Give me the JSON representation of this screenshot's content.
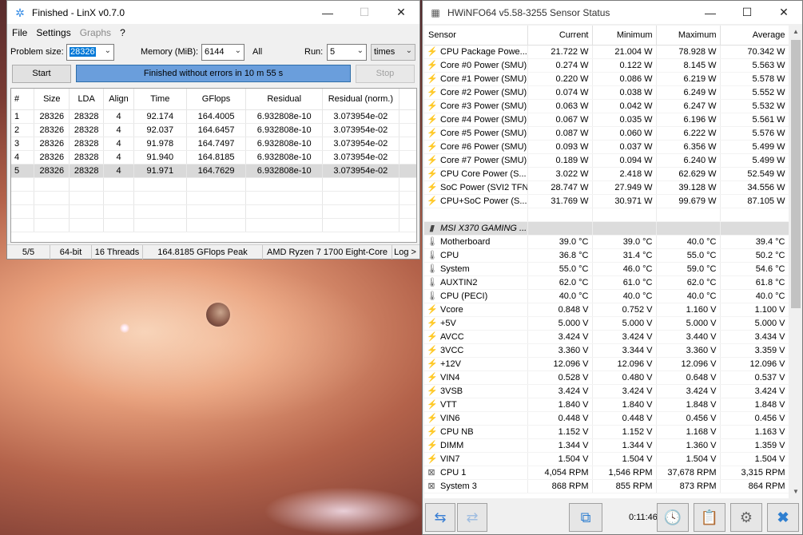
{
  "linx": {
    "title": "Finished - LinX v0.7.0",
    "menu": [
      "File",
      "Settings",
      "Graphs",
      "?"
    ],
    "params": {
      "problem_size_label": "Problem size:",
      "problem_size_value": "28326",
      "memory_label": "Memory (MiB):",
      "memory_value": "6144",
      "all_label": "All",
      "run_label": "Run:",
      "run_value": "5",
      "times_value": "times"
    },
    "buttons": {
      "start": "Start",
      "stop": "Stop"
    },
    "status_text": "Finished without errors in 10 m 55 s",
    "columns": [
      "#",
      "Size",
      "LDA",
      "Align",
      "Time",
      "GFlops",
      "Residual",
      "Residual (norm.)"
    ],
    "rows": [
      [
        "1",
        "28326",
        "28328",
        "4",
        "92.174",
        "164.4005",
        "6.932808e-10",
        "3.073954e-02"
      ],
      [
        "2",
        "28326",
        "28328",
        "4",
        "92.037",
        "164.6457",
        "6.932808e-10",
        "3.073954e-02"
      ],
      [
        "3",
        "28326",
        "28328",
        "4",
        "91.978",
        "164.7497",
        "6.932808e-10",
        "3.073954e-02"
      ],
      [
        "4",
        "28326",
        "28328",
        "4",
        "91.940",
        "164.8185",
        "6.932808e-10",
        "3.073954e-02"
      ],
      [
        "5",
        "28326",
        "28328",
        "4",
        "91.971",
        "164.7629",
        "6.932808e-10",
        "3.073954e-02"
      ]
    ],
    "statusbar": {
      "progress": "5/5",
      "bits": "64-bit",
      "threads": "16 Threads",
      "peak": "164.8185 GFlops Peak",
      "cpu": "AMD Ryzen 7 1700 Eight-Core",
      "log": "Log >"
    }
  },
  "hwinfo": {
    "title": "HWiNFO64 v5.58-3255 Sensor Status",
    "columns": [
      "Sensor",
      "Current",
      "Minimum",
      "Maximum",
      "Average"
    ],
    "rows": [
      {
        "icon": "power",
        "name": "CPU Package Powe...",
        "cur": "21.722 W",
        "min": "21.004 W",
        "max": "78.928 W",
        "avg": "70.342 W"
      },
      {
        "icon": "power",
        "name": "Core #0 Power (SMU)",
        "cur": "0.274 W",
        "min": "0.122 W",
        "max": "8.145 W",
        "avg": "5.563 W"
      },
      {
        "icon": "power",
        "name": "Core #1 Power (SMU)",
        "cur": "0.220 W",
        "min": "0.086 W",
        "max": "6.219 W",
        "avg": "5.578 W"
      },
      {
        "icon": "power",
        "name": "Core #2 Power (SMU)",
        "cur": "0.074 W",
        "min": "0.038 W",
        "max": "6.249 W",
        "avg": "5.552 W"
      },
      {
        "icon": "power",
        "name": "Core #3 Power (SMU)",
        "cur": "0.063 W",
        "min": "0.042 W",
        "max": "6.247 W",
        "avg": "5.532 W"
      },
      {
        "icon": "power",
        "name": "Core #4 Power (SMU)",
        "cur": "0.067 W",
        "min": "0.035 W",
        "max": "6.196 W",
        "avg": "5.561 W"
      },
      {
        "icon": "power",
        "name": "Core #5 Power (SMU)",
        "cur": "0.087 W",
        "min": "0.060 W",
        "max": "6.222 W",
        "avg": "5.576 W"
      },
      {
        "icon": "power",
        "name": "Core #6 Power (SMU)",
        "cur": "0.093 W",
        "min": "0.037 W",
        "max": "6.356 W",
        "avg": "5.499 W"
      },
      {
        "icon": "power",
        "name": "Core #7 Power (SMU)",
        "cur": "0.189 W",
        "min": "0.094 W",
        "max": "6.240 W",
        "avg": "5.499 W"
      },
      {
        "icon": "power",
        "name": "CPU Core Power (S...",
        "cur": "3.022 W",
        "min": "2.418 W",
        "max": "62.629 W",
        "avg": "52.549 W"
      },
      {
        "icon": "power",
        "name": "SoC Power (SVI2 TFN)",
        "cur": "28.747 W",
        "min": "27.949 W",
        "max": "39.128 W",
        "avg": "34.556 W"
      },
      {
        "icon": "power",
        "name": "CPU+SoC Power (S...",
        "cur": "31.769 W",
        "min": "30.971 W",
        "max": "99.679 W",
        "avg": "87.105 W"
      },
      {
        "icon": "blank",
        "name": "",
        "cur": "",
        "min": "",
        "max": "",
        "avg": ""
      },
      {
        "icon": "chip",
        "name": "MSI X370 GAMING ...",
        "cur": "",
        "min": "",
        "max": "",
        "avg": "",
        "group": true
      },
      {
        "icon": "temp",
        "name": "Motherboard",
        "cur": "39.0 °C",
        "min": "39.0 °C",
        "max": "40.0 °C",
        "avg": "39.4 °C"
      },
      {
        "icon": "temp",
        "name": "CPU",
        "cur": "36.8 °C",
        "min": "31.4 °C",
        "max": "55.0 °C",
        "avg": "50.2 °C"
      },
      {
        "icon": "temp",
        "name": "System",
        "cur": "55.0 °C",
        "min": "46.0 °C",
        "max": "59.0 °C",
        "avg": "54.6 °C"
      },
      {
        "icon": "temp",
        "name": "AUXTIN2",
        "cur": "62.0 °C",
        "min": "61.0 °C",
        "max": "62.0 °C",
        "avg": "61.8 °C"
      },
      {
        "icon": "temp",
        "name": "CPU (PECI)",
        "cur": "40.0 °C",
        "min": "40.0 °C",
        "max": "40.0 °C",
        "avg": "40.0 °C"
      },
      {
        "icon": "volt",
        "name": "Vcore",
        "cur": "0.848 V",
        "min": "0.752 V",
        "max": "1.160 V",
        "avg": "1.100 V"
      },
      {
        "icon": "volt",
        "name": "+5V",
        "cur": "5.000 V",
        "min": "5.000 V",
        "max": "5.000 V",
        "avg": "5.000 V"
      },
      {
        "icon": "volt",
        "name": "AVCC",
        "cur": "3.424 V",
        "min": "3.424 V",
        "max": "3.440 V",
        "avg": "3.434 V"
      },
      {
        "icon": "volt",
        "name": "3VCC",
        "cur": "3.360 V",
        "min": "3.344 V",
        "max": "3.360 V",
        "avg": "3.359 V"
      },
      {
        "icon": "volt",
        "name": "+12V",
        "cur": "12.096 V",
        "min": "12.096 V",
        "max": "12.096 V",
        "avg": "12.096 V"
      },
      {
        "icon": "volt",
        "name": "VIN4",
        "cur": "0.528 V",
        "min": "0.480 V",
        "max": "0.648 V",
        "avg": "0.537 V"
      },
      {
        "icon": "volt",
        "name": "3VSB",
        "cur": "3.424 V",
        "min": "3.424 V",
        "max": "3.424 V",
        "avg": "3.424 V"
      },
      {
        "icon": "volt",
        "name": "VTT",
        "cur": "1.840 V",
        "min": "1.840 V",
        "max": "1.848 V",
        "avg": "1.848 V"
      },
      {
        "icon": "volt",
        "name": "VIN6",
        "cur": "0.448 V",
        "min": "0.448 V",
        "max": "0.456 V",
        "avg": "0.456 V"
      },
      {
        "icon": "volt",
        "name": "CPU NB",
        "cur": "1.152 V",
        "min": "1.152 V",
        "max": "1.168 V",
        "avg": "1.163 V"
      },
      {
        "icon": "volt",
        "name": "DIMM",
        "cur": "1.344 V",
        "min": "1.344 V",
        "max": "1.360 V",
        "avg": "1.359 V"
      },
      {
        "icon": "volt",
        "name": "VIN7",
        "cur": "1.504 V",
        "min": "1.504 V",
        "max": "1.504 V",
        "avg": "1.504 V"
      },
      {
        "icon": "fan",
        "name": "CPU 1",
        "cur": "4,054 RPM",
        "min": "1,546 RPM",
        "max": "37,678 RPM",
        "avg": "3,315 RPM"
      },
      {
        "icon": "fan",
        "name": "System 3",
        "cur": "868 RPM",
        "min": "855 RPM",
        "max": "873 RPM",
        "avg": "864 RPM"
      }
    ],
    "timer": "0:11:46"
  }
}
